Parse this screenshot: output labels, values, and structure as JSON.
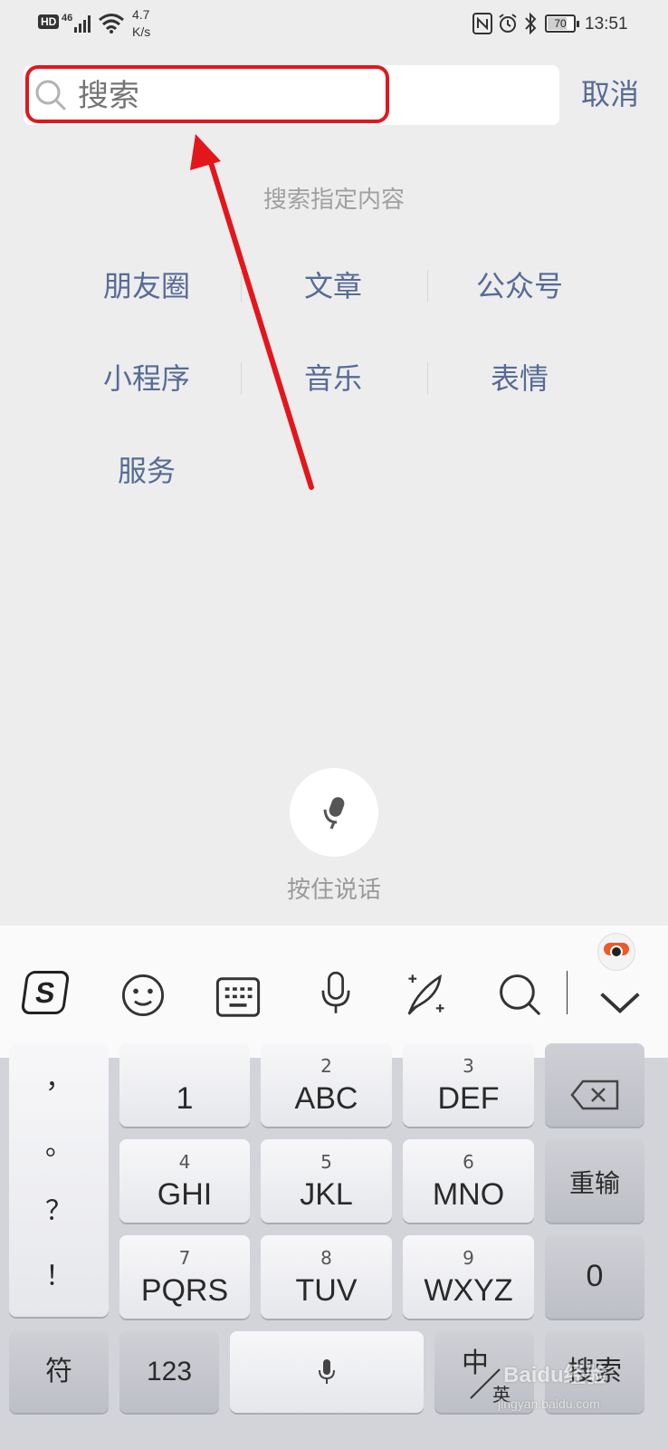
{
  "status_bar": {
    "hd": "HD",
    "network": "46",
    "speed_value": "4.7",
    "speed_unit": "K/s",
    "battery": "70",
    "time": "13:51"
  },
  "search": {
    "placeholder": "搜索",
    "cancel_label": "取消"
  },
  "hint": "搜索指定内容",
  "categories": [
    "朋友圈",
    "文章",
    "公众号",
    "小程序",
    "音乐",
    "表情",
    "服务"
  ],
  "voice": {
    "label": "按住说话"
  },
  "keyboard": {
    "toolbar_icons": [
      "sogou-logo-icon",
      "emoji-icon",
      "keyboard-icon",
      "microphone-icon",
      "handwriting-icon",
      "search-icon",
      "collapse-icon"
    ],
    "punctuation": [
      "，",
      "。",
      "？",
      "！"
    ],
    "keys": [
      {
        "num": "",
        "label": "1"
      },
      {
        "num": "2",
        "label": "ABC"
      },
      {
        "num": "3",
        "label": "DEF"
      },
      {
        "num": "4",
        "label": "GHI"
      },
      {
        "num": "5",
        "label": "JKL"
      },
      {
        "num": "6",
        "label": "MNO"
      },
      {
        "num": "7",
        "label": "PQRS"
      },
      {
        "num": "8",
        "label": "TUV"
      },
      {
        "num": "9",
        "label": "WXYZ"
      }
    ],
    "reenter_label": "重输",
    "zero_label": "0",
    "symbol_label": "符",
    "numbers_label": "123",
    "lang_zh": "中",
    "lang_en": "英",
    "search_label": "搜索"
  },
  "watermark": {
    "text": "Baidu经验",
    "url": "jingyan.baidu.com"
  },
  "colors": {
    "link": "#576b95",
    "annotation": "#e3161c",
    "background": "#ededed"
  }
}
